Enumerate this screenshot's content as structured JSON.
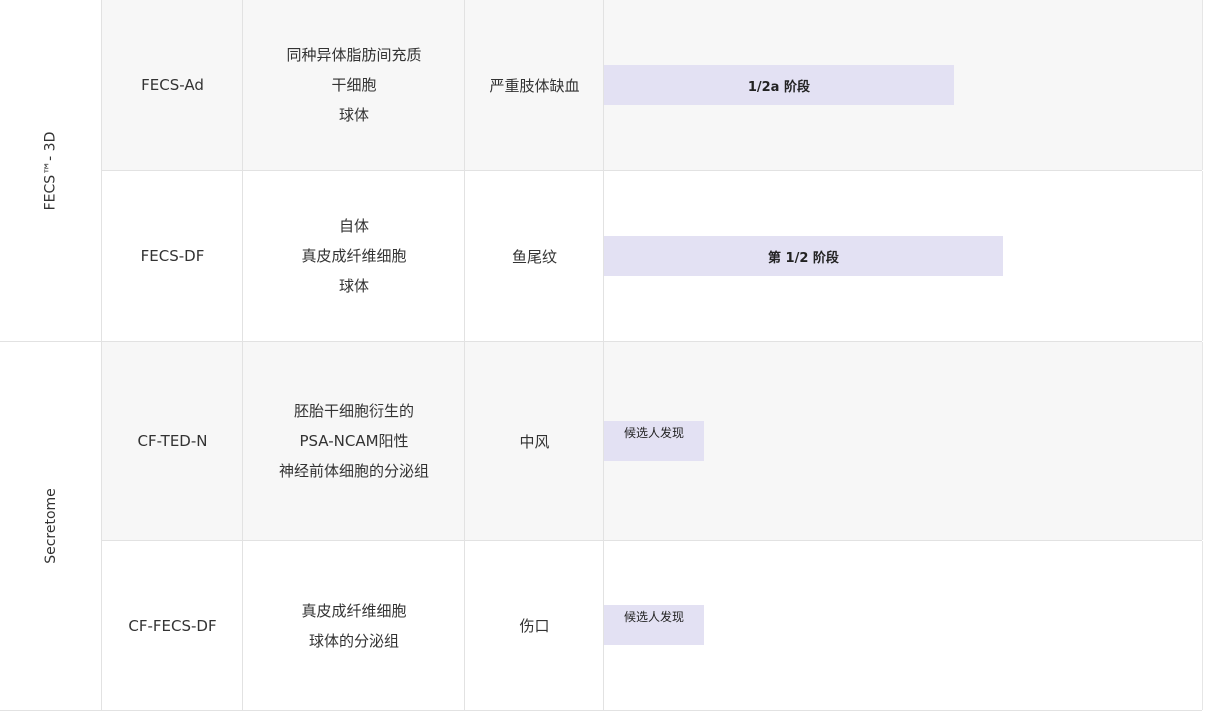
{
  "groups": [
    {
      "label": "FECS™- 3D"
    },
    {
      "label": "Secretome"
    }
  ],
  "rows": [
    {
      "code": "FECS-Ad",
      "desc": [
        "同种异体脂肪间充质",
        "干细胞",
        "球体"
      ],
      "indication": "严重肢体缺血",
      "stage": "1/2a 阶段",
      "progress_pct": 58.4
    },
    {
      "code": "FECS-DF",
      "desc": [
        "自体",
        "真皮成纤维细胞",
        "球体"
      ],
      "indication": "鱼尾纹",
      "stage": "第 1/2 阶段",
      "progress_pct": 66.6
    },
    {
      "code": "CF-TED-N",
      "desc": [
        "胚胎干细胞衍生的",
        "PSA-NCAM阳性",
        "神经前体细胞的分泌组"
      ],
      "indication": "中风",
      "stage": "候选人发现",
      "progress_pct": 16.7
    },
    {
      "code": "CF-FECS-DF",
      "desc": [
        "真皮成纤维细胞",
        "球体的分泌组"
      ],
      "indication": "伤口",
      "stage": "候选人发现",
      "progress_pct": 16.7
    }
  ],
  "colors": {
    "bar": "#e3e1f3",
    "row_alt": "#f7f7f7",
    "border": "#e2e2e2"
  }
}
